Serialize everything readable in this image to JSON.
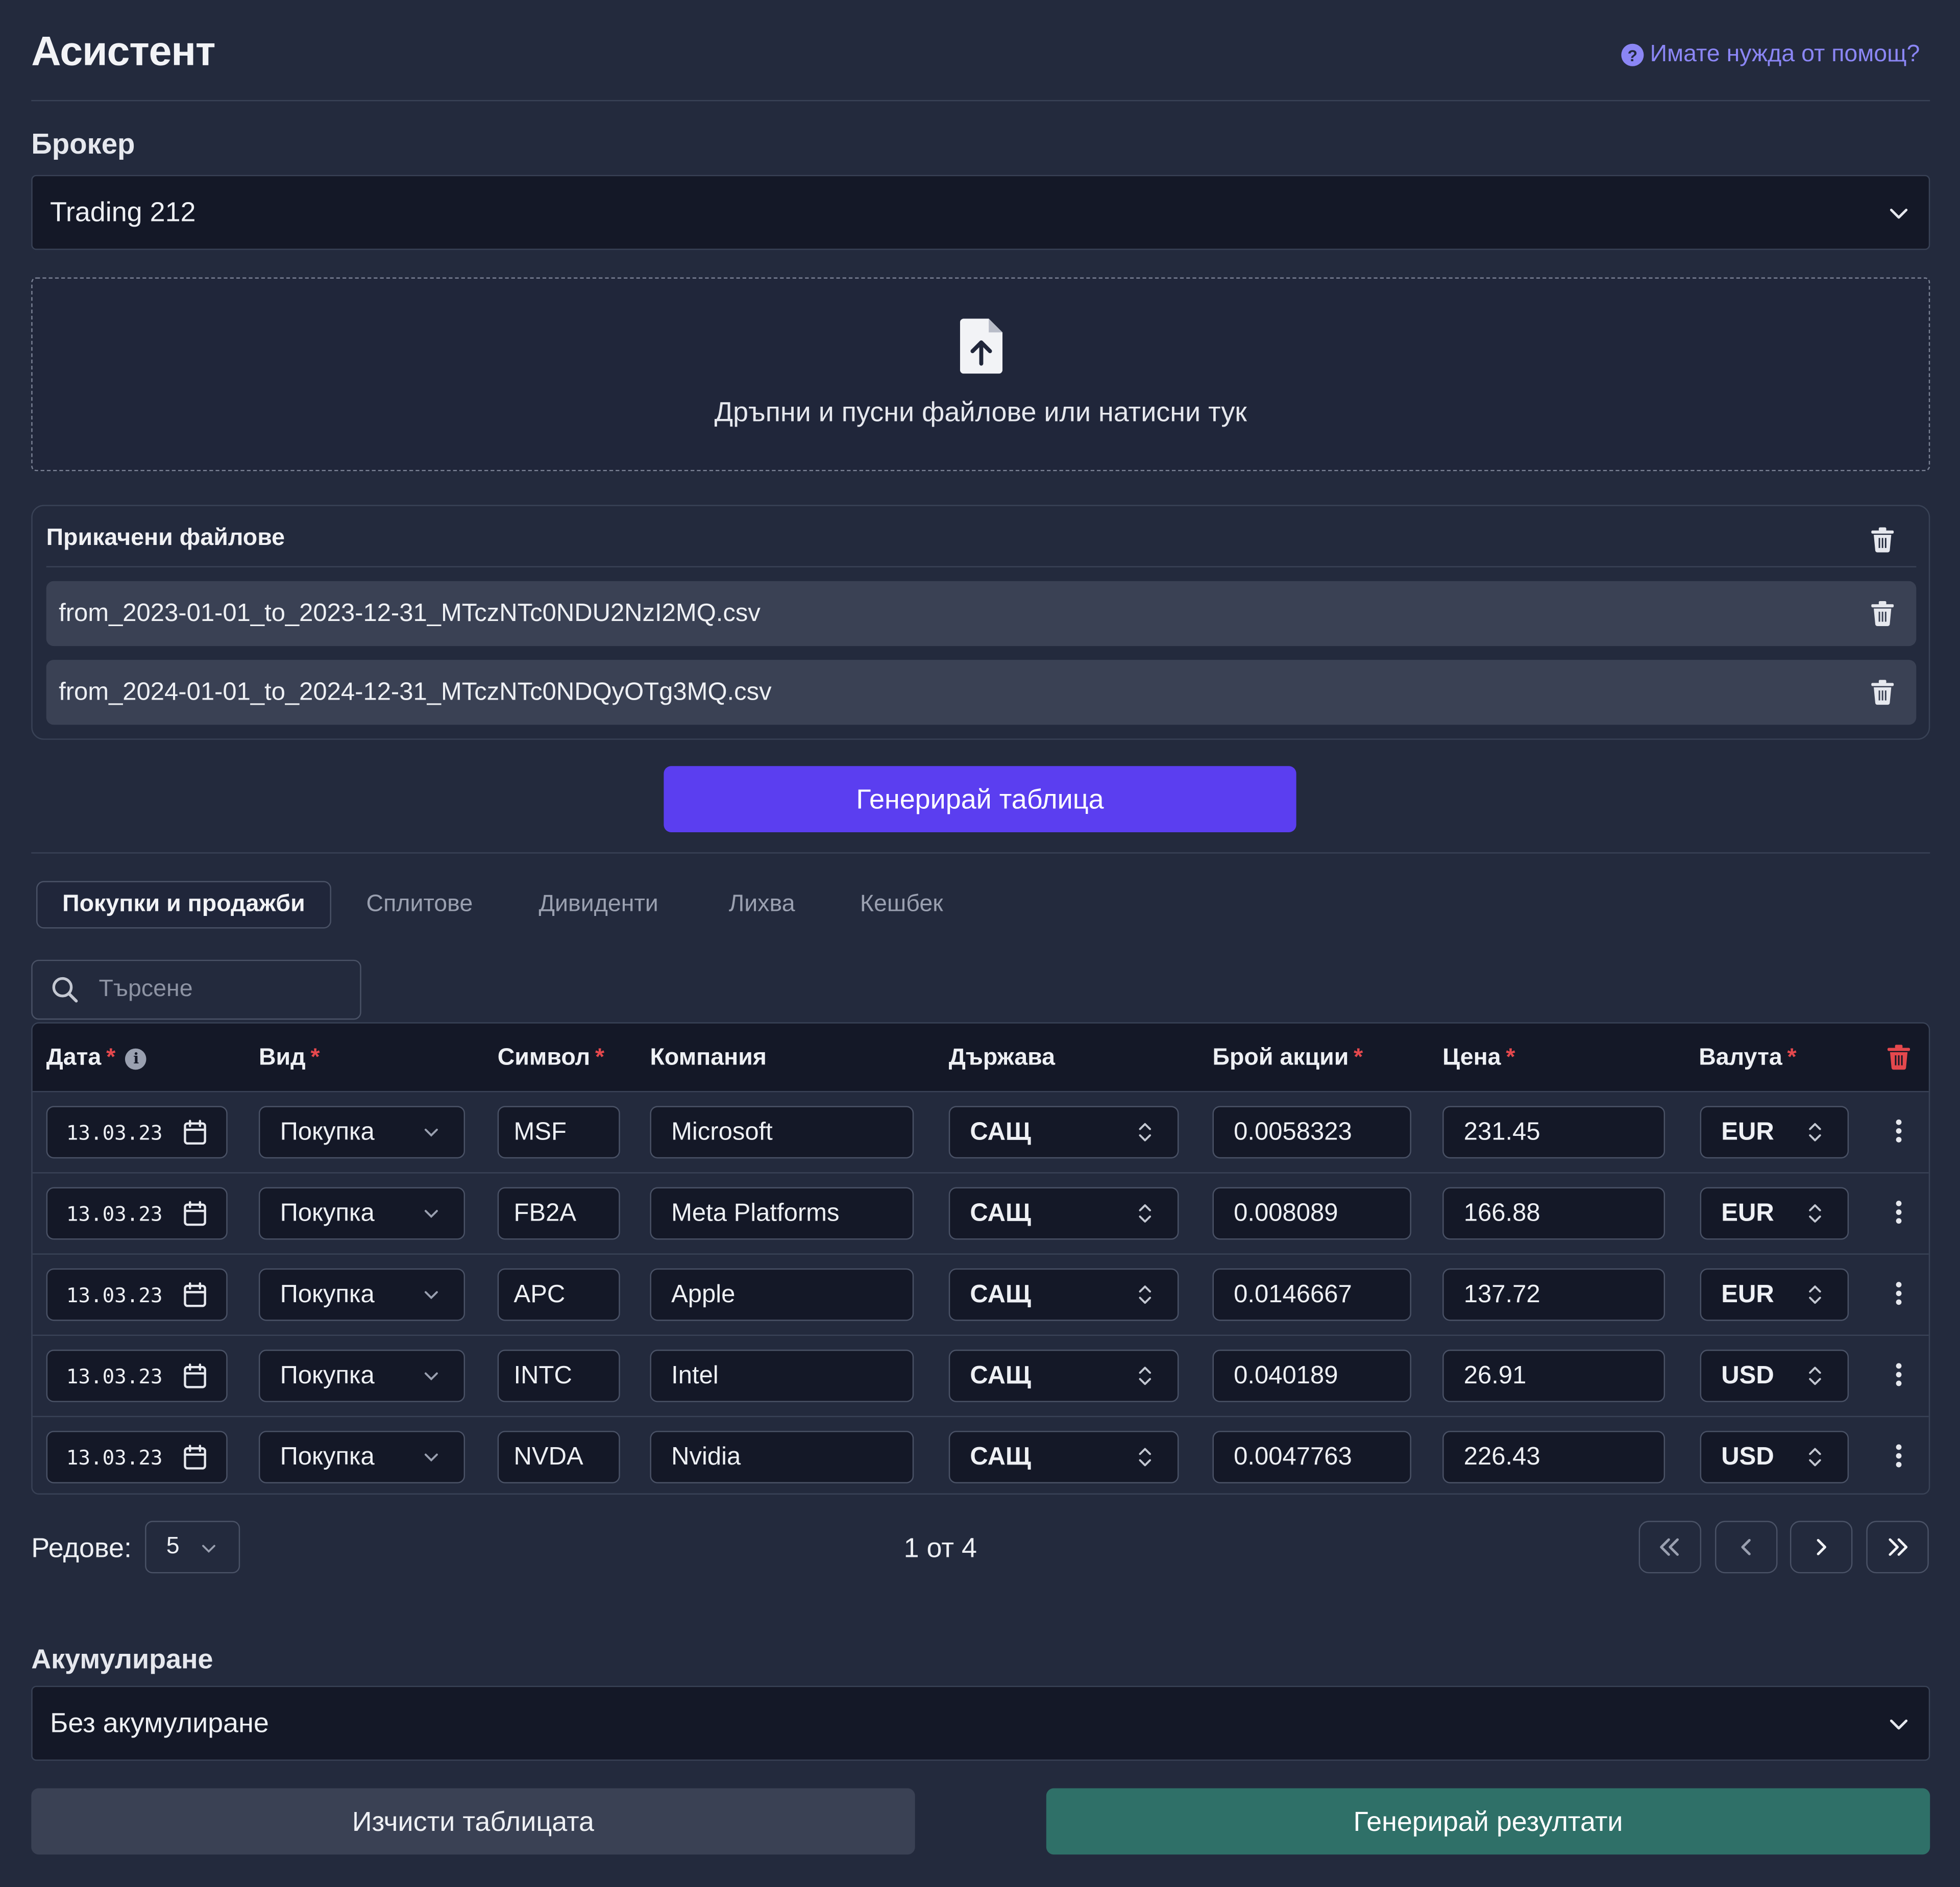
{
  "header": {
    "title": "Асистент",
    "help_link": "Имате нужда от помощ?"
  },
  "broker": {
    "label": "Брокер",
    "selected": "Trading 212"
  },
  "dropzone": {
    "text": "Дръпни и пусни файлове или натисни тук"
  },
  "attached": {
    "title": "Прикачени файлове",
    "files": [
      "from_2023-01-01_to_2023-12-31_MTczNTc0NDU2NzI2MQ.csv",
      "from_2024-01-01_to_2024-12-31_MTczNTc0NDQyOTg3MQ.csv"
    ]
  },
  "generate_table_button": "Генерирай таблица",
  "tabs": [
    {
      "label": "Покупки и продажби",
      "active": true
    },
    {
      "label": "Сплитове",
      "active": false
    },
    {
      "label": "Дивиденти",
      "active": false
    },
    {
      "label": "Лихва",
      "active": false
    },
    {
      "label": "Кешбек",
      "active": false
    }
  ],
  "search": {
    "placeholder": "Търсене",
    "value": ""
  },
  "table": {
    "columns": {
      "date": "Дата",
      "type": "Вид",
      "symbol": "Символ",
      "company": "Компания",
      "country": "Държава",
      "shares": "Брой акции",
      "price": "Цена",
      "currency": "Валута"
    },
    "required_marker": "*",
    "info_marker": "i",
    "rows": [
      {
        "date": "13.03.23",
        "type": "Покупка",
        "symbol": "MSF",
        "company": "Microsoft",
        "country": "САЩ",
        "shares": "0.0058323",
        "price": "231.45",
        "currency": "EUR"
      },
      {
        "date": "13.03.23",
        "type": "Покупка",
        "symbol": "FB2A",
        "company": "Meta Platforms",
        "country": "САЩ",
        "shares": "0.008089",
        "price": "166.88",
        "currency": "EUR"
      },
      {
        "date": "13.03.23",
        "type": "Покупка",
        "symbol": "APC",
        "company": "Apple",
        "country": "САЩ",
        "shares": "0.0146667",
        "price": "137.72",
        "currency": "EUR"
      },
      {
        "date": "13.03.23",
        "type": "Покупка",
        "symbol": "INTC",
        "company": "Intel",
        "country": "САЩ",
        "shares": "0.040189",
        "price": "26.91",
        "currency": "USD"
      },
      {
        "date": "13.03.23",
        "type": "Покупка",
        "symbol": "NVDA",
        "company": "Nvidia",
        "country": "САЩ",
        "shares": "0.0047763",
        "price": "226.43",
        "currency": "USD"
      }
    ]
  },
  "pagination": {
    "rows_label": "Редове:",
    "rows_per_page": "5",
    "page_indicator": "1 от 4"
  },
  "accumulation": {
    "label": "Акумулиране",
    "selected": "Без акумулиране"
  },
  "clear_table_button": "Изчисти таблицата",
  "generate_results_button": "Генерирай резултати",
  "colors": {
    "background": "#232a3d",
    "accent_purple": "#5b3ef0",
    "accent_teal": "#2f7068",
    "link": "#8b86f5",
    "required": "#e5484d"
  }
}
